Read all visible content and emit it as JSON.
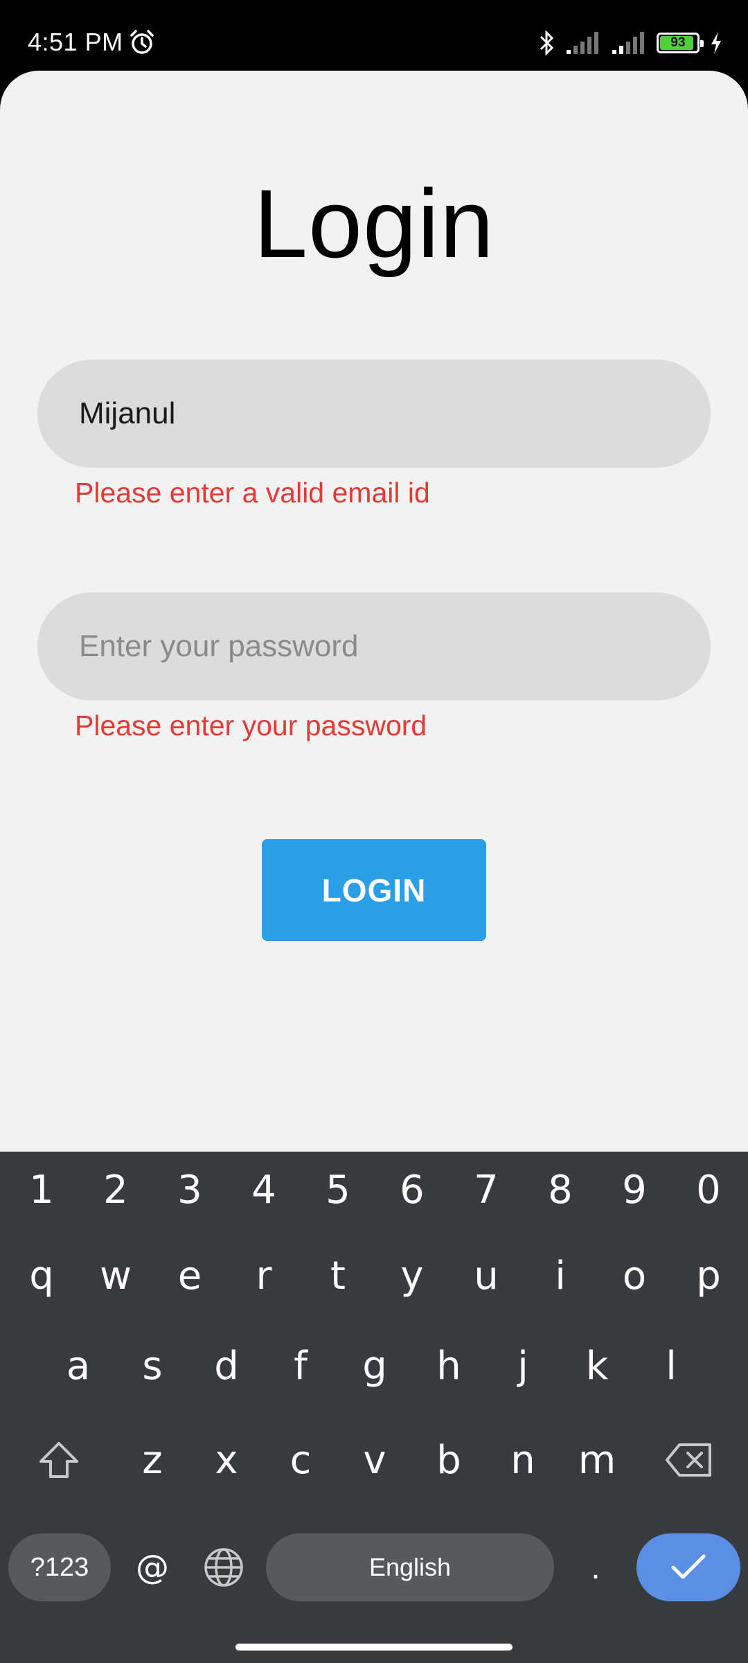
{
  "status_bar": {
    "time": "4:51 PM",
    "battery_level": "93",
    "battery_fraction": 0.93,
    "icons": [
      "alarm-icon",
      "bluetooth-icon",
      "signal-icon",
      "signal-icon",
      "battery-icon",
      "charging-icon"
    ]
  },
  "login": {
    "title": "Login",
    "email_value": "Mijanul",
    "email_error": "Please enter a valid email id",
    "password_placeholder": "Enter your password",
    "password_error": "Please enter your password",
    "button_label": "LOGIN"
  },
  "keyboard": {
    "numbers": [
      "1",
      "2",
      "3",
      "4",
      "5",
      "6",
      "7",
      "8",
      "9",
      "0"
    ],
    "row1": [
      "q",
      "w",
      "e",
      "r",
      "t",
      "y",
      "u",
      "i",
      "o",
      "p"
    ],
    "row2": [
      "a",
      "s",
      "d",
      "f",
      "g",
      "h",
      "j",
      "k",
      "l"
    ],
    "row3": [
      "z",
      "x",
      "c",
      "v",
      "b",
      "n",
      "m"
    ],
    "symbols_label": "?123",
    "at_label": "@",
    "space_label": "English",
    "period_label": ".",
    "icons": [
      "shift-icon",
      "backspace-icon",
      "globe-icon",
      "check-icon"
    ]
  },
  "colors": {
    "accent": "#2a9fe8",
    "error": "#e53935",
    "app_background": "#f2f2f2",
    "field_background": "#dcdcdc",
    "keyboard_background": "#373b40",
    "enter_key": "#5b8fe6"
  }
}
